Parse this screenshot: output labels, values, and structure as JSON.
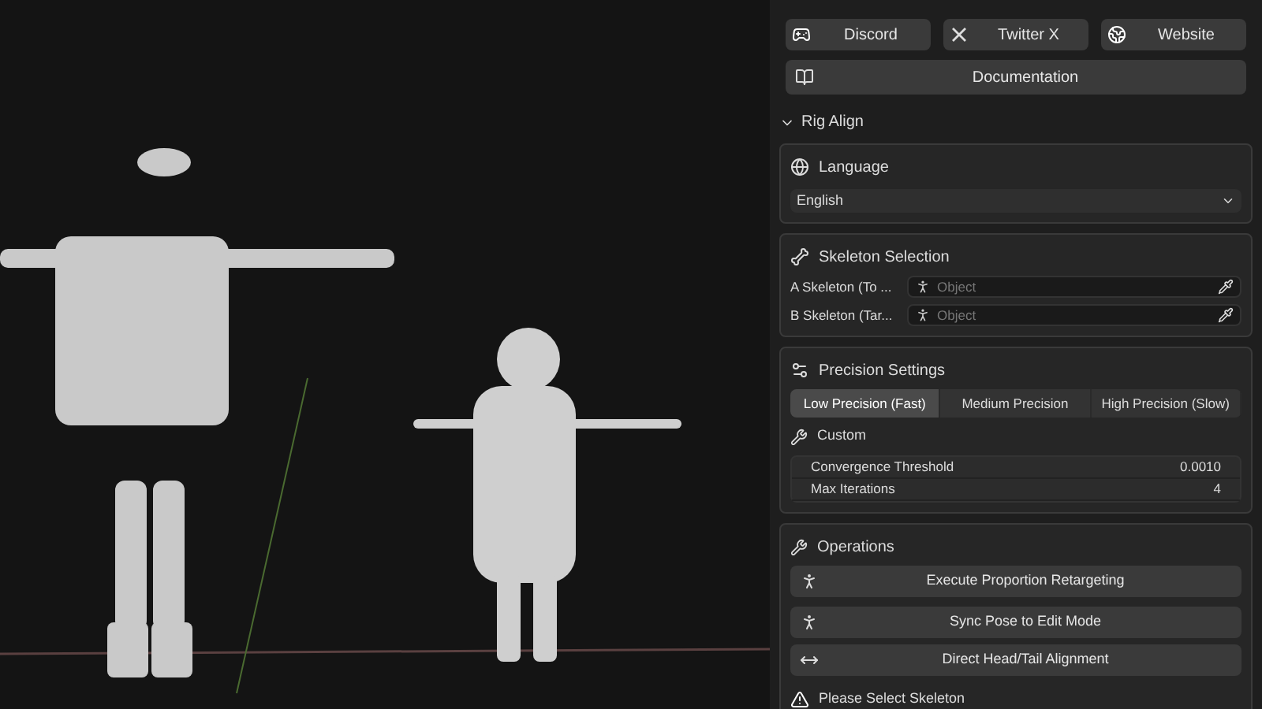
{
  "links": [
    {
      "label": "Discord",
      "kind": "discord"
    },
    {
      "label": "Twitter X",
      "kind": "x"
    },
    {
      "label": "Website",
      "kind": "web"
    }
  ],
  "documentation": {
    "label": "Documentation"
  },
  "panel": {
    "title": "Rig Align",
    "expanded": true
  },
  "language": {
    "title": "Language",
    "value": "English"
  },
  "skeleton": {
    "title": "Skeleton Selection",
    "fields": [
      {
        "label": "A Skeleton (To ...",
        "placeholder": "Object"
      },
      {
        "label": "B Skeleton (Tar...",
        "placeholder": "Object"
      }
    ]
  },
  "precision": {
    "title": "Precision Settings",
    "options": [
      {
        "label": "Low Precision (Fast)",
        "selected": true
      },
      {
        "label": "Medium Precision",
        "selected": false
      },
      {
        "label": "High Precision (Slow)",
        "selected": false
      }
    ],
    "custom_title": "Custom",
    "params": [
      {
        "label": "Convergence Threshold",
        "value": "0.0010"
      },
      {
        "label": "Max Iterations",
        "value": "4"
      }
    ]
  },
  "operations": {
    "title": "Operations",
    "buttons": [
      {
        "label": "Execute Proportion Retargeting",
        "kind": "run"
      },
      {
        "label": "Sync Pose to Edit Mode",
        "kind": "run"
      },
      {
        "label": "Direct Head/Tail Alignment",
        "kind": "arrows"
      }
    ],
    "warning": "Please Select Skeleton"
  }
}
